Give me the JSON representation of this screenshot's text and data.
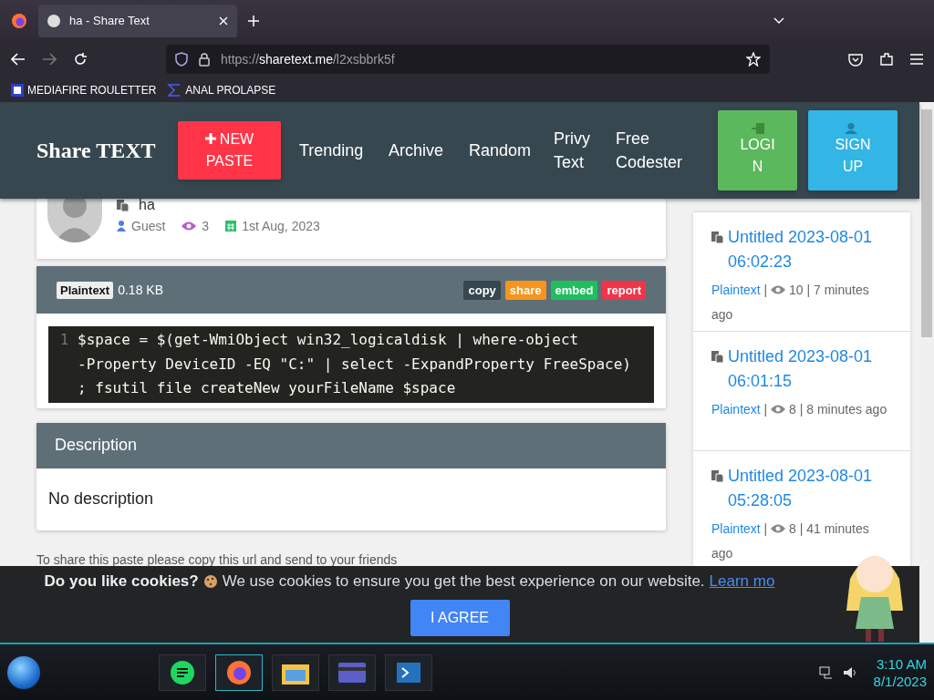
{
  "browser": {
    "tab": {
      "title": "ha - Share Text",
      "selected": true
    },
    "url": {
      "scheme": "https://",
      "host": "sharetext.me",
      "path": "/l2xsbbrk5f"
    },
    "bookmarks": [
      {
        "label": "MEDIAFIRE ROULETTER",
        "kind": "mf"
      },
      {
        "label": "ANAL PROLAPSE",
        "kind": "sigma"
      }
    ]
  },
  "site": {
    "logo": "Share TEXT",
    "new_paste": "NEW PASTE",
    "nav": [
      "Trending",
      "Archive",
      "Random",
      "Privy Text",
      "Free Codester"
    ],
    "login": "LOGIN",
    "signup": "SIGN UP"
  },
  "paste": {
    "title": "ha",
    "author": "Guest",
    "views": "3",
    "date": "1st Aug, 2023",
    "syntax": "Plaintext",
    "size": "0.18 KB",
    "actions": [
      {
        "label": "copy",
        "color": "#37474f"
      },
      {
        "label": "share",
        "color": "#f7941d"
      },
      {
        "label": "embed",
        "color": "#1fbf5f"
      },
      {
        "label": "report",
        "color": "#f0344a"
      }
    ],
    "code": [
      {
        "number": "1",
        "text": "$space = $(get-WmiObject win32_logicaldisk | where-object -Property DeviceID -EQ \"C:\" | select -ExpandProperty FreeSpace) ; fsutil file createNew yourFileName $space"
      }
    ],
    "description_title": "Description",
    "description": "No description",
    "share_hint": "To share this paste please copy this url and send to your friends"
  },
  "sidebar": [
    {
      "title": "Untitled 2023-08-01 06:02:23",
      "syntax": "Plaintext",
      "separators": [
        "|",
        "|"
      ],
      "views": "10",
      "age": "7 minutes ago"
    },
    {
      "title": "Untitled 2023-08-01 06:01:15",
      "syntax": "Plaintext",
      "separators": [
        "|",
        "|"
      ],
      "views": "8",
      "age": "8 minutes ago"
    },
    {
      "title": "Untitled 2023-08-01 05:28:05",
      "syntax": "Plaintext",
      "separators": [
        "|",
        "|"
      ],
      "views": "8",
      "age": "41 minutes ago"
    }
  ],
  "cookie": {
    "question": "Do you like cookies?",
    "text": "We use cookies to ensure you get the best experience on our website.",
    "link": "Learn mo",
    "button": "I AGREE"
  },
  "taskbar": {
    "time": "3:10 AM",
    "date": "8/1/2023"
  }
}
